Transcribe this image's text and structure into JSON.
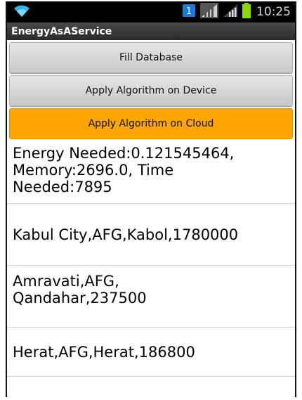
{
  "status_bar": {
    "time": "10:25",
    "icons": [
      "wifi-icon",
      "notification-icon",
      "signal-icon",
      "signal-icon",
      "battery-icon"
    ],
    "notification_badge": "1"
  },
  "app": {
    "title": "EnergyAsAService"
  },
  "buttons": {
    "fill_database": "Fill Database",
    "apply_device": "Apply Algorithm on Device",
    "apply_cloud": "Apply Algorithm on Cloud"
  },
  "list": {
    "items": [
      "Energy Needed:0.121545464,\nMemory:2696.0, Time\nNeeded:7895",
      "Kabul City,AFG,Kabol,1780000",
      "Amravati,AFG,\nQandahar,237500",
      "Herat,AFG,Herat,186800"
    ]
  },
  "colors": {
    "accent_button": "#ffa500",
    "status_bar": "#000000",
    "title_bar": "#333333",
    "battery": "#8fd400",
    "wifi": "#33b5e5"
  }
}
